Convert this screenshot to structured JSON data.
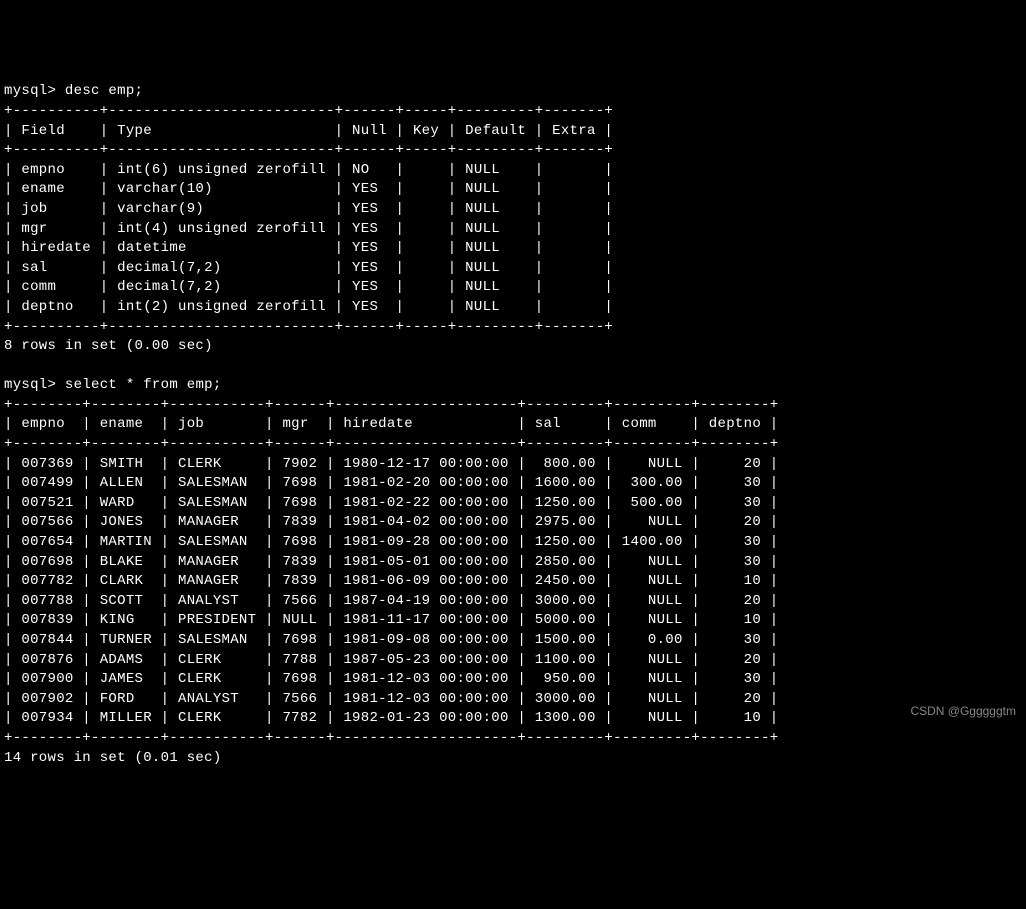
{
  "prompt": "mysql>",
  "cmd1": "desc emp;",
  "cmd2": "select * from emp;",
  "desc_table": {
    "sep": "+----------+--------------------------+------+-----+---------+-------+",
    "header": "| Field    | Type                     | Null | Key | Default | Extra |",
    "rows": [
      "| empno    | int(6) unsigned zerofill | NO   |     | NULL    |       |",
      "| ename    | varchar(10)              | YES  |     | NULL    |       |",
      "| job      | varchar(9)               | YES  |     | NULL    |       |",
      "| mgr      | int(4) unsigned zerofill | YES  |     | NULL    |       |",
      "| hiredate | datetime                 | YES  |     | NULL    |       |",
      "| sal      | decimal(7,2)             | YES  |     | NULL    |       |",
      "| comm     | decimal(7,2)             | YES  |     | NULL    |       |",
      "| deptno   | int(2) unsigned zerofill | YES  |     | NULL    |       |"
    ]
  },
  "desc_summary": "8 rows in set (0.00 sec)",
  "select_table": {
    "sep": "+--------+--------+-----------+------+---------------------+---------+---------+--------+",
    "header": "| empno  | ename  | job       | mgr  | hiredate            | sal     | comm    | deptno |",
    "rows": [
      "| 007369 | SMITH  | CLERK     | 7902 | 1980-12-17 00:00:00 |  800.00 |    NULL |     20 |",
      "| 007499 | ALLEN  | SALESMAN  | 7698 | 1981-02-20 00:00:00 | 1600.00 |  300.00 |     30 |",
      "| 007521 | WARD   | SALESMAN  | 7698 | 1981-02-22 00:00:00 | 1250.00 |  500.00 |     30 |",
      "| 007566 | JONES  | MANAGER   | 7839 | 1981-04-02 00:00:00 | 2975.00 |    NULL |     20 |",
      "| 007654 | MARTIN | SALESMAN  | 7698 | 1981-09-28 00:00:00 | 1250.00 | 1400.00 |     30 |",
      "| 007698 | BLAKE  | MANAGER   | 7839 | 1981-05-01 00:00:00 | 2850.00 |    NULL |     30 |",
      "| 007782 | CLARK  | MANAGER   | 7839 | 1981-06-09 00:00:00 | 2450.00 |    NULL |     10 |",
      "| 007788 | SCOTT  | ANALYST   | 7566 | 1987-04-19 00:00:00 | 3000.00 |    NULL |     20 |",
      "| 007839 | KING   | PRESIDENT | NULL | 1981-11-17 00:00:00 | 5000.00 |    NULL |     10 |",
      "| 007844 | TURNER | SALESMAN  | 7698 | 1981-09-08 00:00:00 | 1500.00 |    0.00 |     30 |",
      "| 007876 | ADAMS  | CLERK     | 7788 | 1987-05-23 00:00:00 | 1100.00 |    NULL |     20 |",
      "| 007900 | JAMES  | CLERK     | 7698 | 1981-12-03 00:00:00 |  950.00 |    NULL |     30 |",
      "| 007902 | FORD   | ANALYST   | 7566 | 1981-12-03 00:00:00 | 3000.00 |    NULL |     20 |",
      "| 007934 | MILLER | CLERK     | 7782 | 1982-01-23 00:00:00 | 1300.00 |    NULL |     10 |"
    ]
  },
  "select_summary": "14 rows in set (0.01 sec)",
  "watermark": "CSDN @Ggggggtm"
}
